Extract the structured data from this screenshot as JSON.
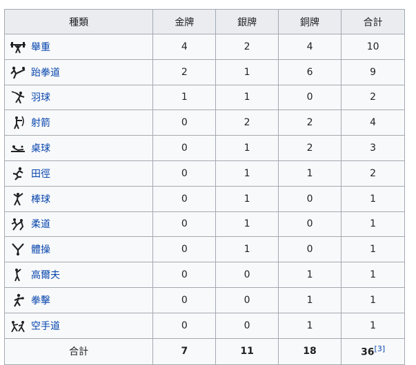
{
  "headers": {
    "sport": "種類",
    "gold": "金牌",
    "silver": "銀牌",
    "bronze": "銅牌",
    "total": "合計"
  },
  "colors": {
    "gold": "#f7d51c",
    "silver": "#c0c0c0",
    "bronze": "#cc9966",
    "link": "#0645ad"
  },
  "rows": [
    {
      "icon": "weightlifting-icon",
      "sport": "舉重",
      "gold": "4",
      "silver": "2",
      "bronze": "4",
      "total": "10"
    },
    {
      "icon": "taekwondo-icon",
      "sport": "跆拳道",
      "gold": "2",
      "silver": "1",
      "bronze": "6",
      "total": "9"
    },
    {
      "icon": "badminton-icon",
      "sport": "羽球",
      "gold": "1",
      "silver": "1",
      "bronze": "0",
      "total": "2"
    },
    {
      "icon": "archery-icon",
      "sport": "射箭",
      "gold": "0",
      "silver": "2",
      "bronze": "2",
      "total": "4"
    },
    {
      "icon": "table-tennis-icon",
      "sport": "桌球",
      "gold": "0",
      "silver": "1",
      "bronze": "2",
      "total": "3"
    },
    {
      "icon": "athletics-icon",
      "sport": "田徑",
      "gold": "0",
      "silver": "1",
      "bronze": "1",
      "total": "2"
    },
    {
      "icon": "baseball-icon",
      "sport": "棒球",
      "gold": "0",
      "silver": "1",
      "bronze": "0",
      "total": "1"
    },
    {
      "icon": "judo-icon",
      "sport": "柔道",
      "gold": "0",
      "silver": "1",
      "bronze": "0",
      "total": "1"
    },
    {
      "icon": "gymnastics-icon",
      "sport": "體操",
      "gold": "0",
      "silver": "1",
      "bronze": "0",
      "total": "1"
    },
    {
      "icon": "golf-icon",
      "sport": "高爾夫",
      "gold": "0",
      "silver": "0",
      "bronze": "1",
      "total": "1"
    },
    {
      "icon": "boxing-icon",
      "sport": "拳擊",
      "gold": "0",
      "silver": "0",
      "bronze": "1",
      "total": "1"
    },
    {
      "icon": "karate-icon",
      "sport": "空手道",
      "gold": "0",
      "silver": "0",
      "bronze": "1",
      "total": "1"
    }
  ],
  "totals": {
    "label": "合計",
    "gold": "7",
    "silver": "11",
    "bronze": "18",
    "total": "36",
    "footnote": "[3]"
  }
}
